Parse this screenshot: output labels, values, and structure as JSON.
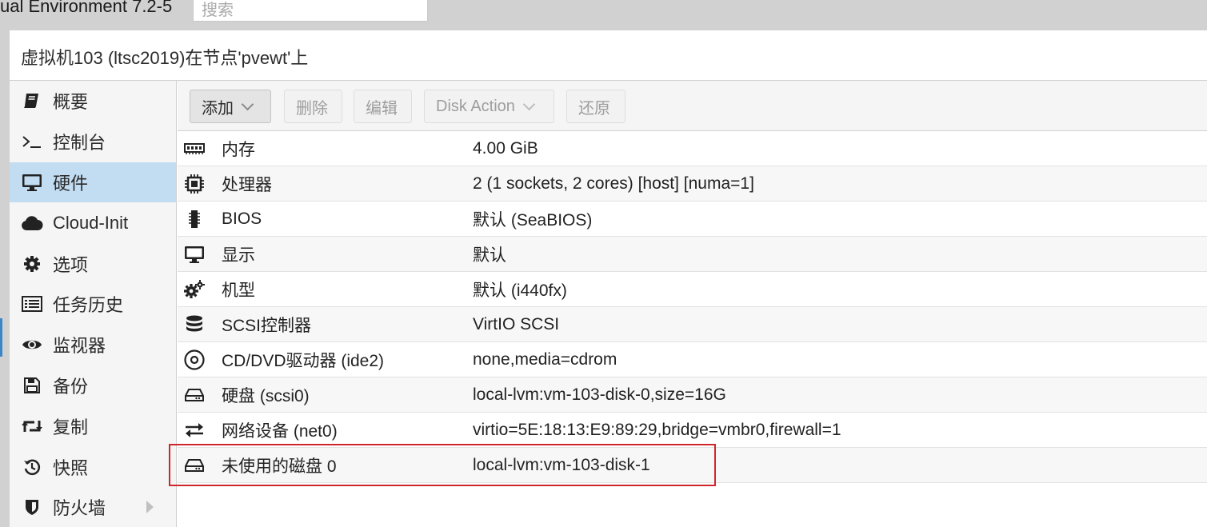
{
  "app": {
    "title": "ual Environment 7.2-5"
  },
  "search": {
    "placeholder": "搜索"
  },
  "panel": {
    "title": "虚拟机103 (ltsc2019)在节点'pvewt'上"
  },
  "sidebar": {
    "items": [
      {
        "label": "概要",
        "icon": "book-icon",
        "selected": false
      },
      {
        "label": "控制台",
        "icon": "terminal-icon",
        "selected": false
      },
      {
        "label": "硬件",
        "icon": "monitor-icon",
        "selected": true
      },
      {
        "label": "Cloud-Init",
        "icon": "cloud-icon",
        "selected": false
      },
      {
        "label": "选项",
        "icon": "gear-icon",
        "selected": false
      },
      {
        "label": "任务历史",
        "icon": "list-icon",
        "selected": false
      },
      {
        "label": "监视器",
        "icon": "eye-icon",
        "selected": false
      },
      {
        "label": "备份",
        "icon": "floppy-icon",
        "selected": false
      },
      {
        "label": "复制",
        "icon": "retweet-icon",
        "selected": false
      },
      {
        "label": "快照",
        "icon": "history-icon",
        "selected": false
      },
      {
        "label": "防火墙",
        "icon": "shield-icon",
        "selected": false
      }
    ]
  },
  "toolbar": {
    "add": "添加",
    "remove": "删除",
    "edit": "编辑",
    "disk_action": "Disk Action",
    "revert": "还原"
  },
  "hardware": {
    "rows": [
      {
        "name": "内存",
        "value": "4.00 GiB",
        "icon": "memory-icon"
      },
      {
        "name": "处理器",
        "value": "2 (1 sockets, 2 cores) [host] [numa=1]",
        "icon": "cpu-icon"
      },
      {
        "name": "BIOS",
        "value": "默认 (SeaBIOS)",
        "icon": "microchip-icon"
      },
      {
        "name": "显示",
        "value": "默认",
        "icon": "desktop-icon"
      },
      {
        "name": "机型",
        "value": "默认 (i440fx)",
        "icon": "cogs-icon"
      },
      {
        "name": "SCSI控制器",
        "value": "VirtIO SCSI",
        "icon": "database-icon"
      },
      {
        "name": "CD/DVD驱动器 (ide2)",
        "value": "none,media=cdrom",
        "icon": "cdrom-icon"
      },
      {
        "name": "硬盘 (scsi0)",
        "value": "local-lvm:vm-103-disk-0,size=16G",
        "icon": "hdd-icon"
      },
      {
        "name": "网络设备 (net0)",
        "value": "virtio=5E:18:13:E9:89:29,bridge=vmbr0,firewall=1",
        "icon": "exchange-icon"
      },
      {
        "name": "未使用的磁盘 0",
        "value": "local-lvm:vm-103-disk-1",
        "icon": "hdd-icon"
      }
    ]
  },
  "colors": {
    "selected_bg": "#c2ddf2",
    "highlight_border": "#d0262b"
  }
}
